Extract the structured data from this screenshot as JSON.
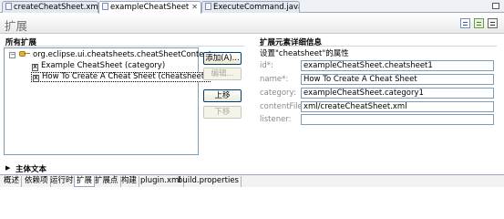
{
  "editor_tabs": [
    {
      "label": "createCheatSheet.xml"
    },
    {
      "label": "exampleCheatSheet",
      "close": "✕"
    },
    {
      "label": "ExecuteCommand.java"
    }
  ],
  "page_title": "扩展",
  "all_extensions": {
    "heading": "所有扩展",
    "tree": {
      "root": {
        "expander": "−",
        "label": "org.eclipse.ui.cheatsheets.cheatSheetContent"
      },
      "children": [
        {
          "icon": "X",
          "label": "Example CheatSheet (category)"
        },
        {
          "icon": "X",
          "label": "How To Create A Cheat Sheet (cheatsheet)"
        }
      ]
    },
    "buttons": {
      "add": "添加(A)...",
      "edit": "编辑...",
      "up": "上移",
      "down": "下移"
    }
  },
  "details": {
    "heading": "扩展元素详细信息",
    "subtitle": "设置\"cheatsheet\"的属性",
    "fields": [
      {
        "label": "id*:",
        "value": "exampleCheatSheet.cheatsheet1"
      },
      {
        "label": "name*:",
        "value": "How To Create A Cheat Sheet"
      },
      {
        "label": "category:",
        "value": "exampleCheatSheet.category1"
      },
      {
        "label": "contentFile:",
        "value": "xml/createCheatSheet.xml"
      },
      {
        "label": "listener:",
        "value": ""
      }
    ]
  },
  "body_text_section": {
    "twisty": "▶",
    "heading": "主体文本"
  },
  "bottom_tabs": [
    {
      "label": "概述"
    },
    {
      "label": "依赖项"
    },
    {
      "label": "运行时"
    },
    {
      "label": "扩展"
    },
    {
      "label": "扩展点"
    },
    {
      "label": "构建"
    },
    {
      "label": "plugin.xml"
    },
    {
      "label": "build.properties"
    }
  ],
  "active_bottom_tab": "扩展"
}
